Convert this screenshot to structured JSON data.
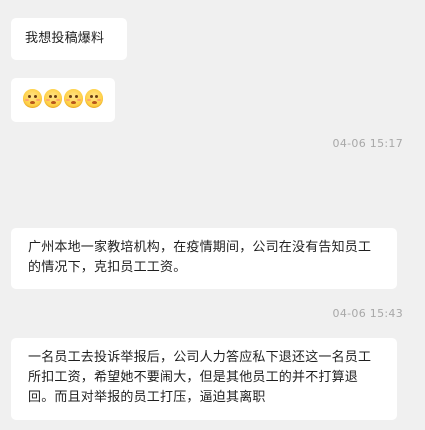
{
  "messages": [
    {
      "text": "我想投稿爆料"
    },
    {
      "emoji_count": 4,
      "emoji_icon": "flushed-face-icon"
    },
    {
      "text": "广州本地一家教培机构，在疫情期间，公司在没有告知员工的情况下，克扣员工工资。"
    },
    {
      "text": "一名员工去投诉举报后，公司人力答应私下退还这一名员工所扣工资，希望她不要闹大，但是其他员工的并不打算退回。而且对举报的员工打压，逼迫其离职"
    }
  ],
  "timestamps": [
    "04-06 15:17",
    "04-06 15:43"
  ],
  "colors": {
    "background": "#f0f0f0",
    "bubble": "#ffffff",
    "text": "#1f1f1f",
    "timestamp": "#a8a8a8"
  }
}
